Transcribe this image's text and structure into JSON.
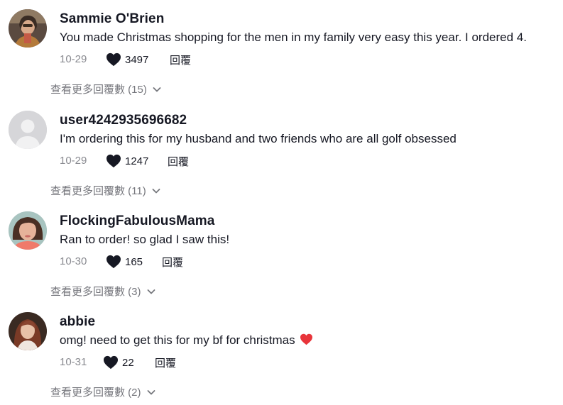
{
  "comments": [
    {
      "username": "Sammie O'Brien",
      "text": "You made Christmas shopping for the men in my family very easy this year. I ordered 4.",
      "date": "10-29",
      "likes": "3497",
      "reply_label": "回覆",
      "view_replies_label": "查看更多回覆數 (15)"
    },
    {
      "username": "user4242935696682",
      "text": "I'm ordering this for my husband and two friends who are all golf obsessed",
      "date": "10-29",
      "likes": "1247",
      "reply_label": "回覆",
      "view_replies_label": "查看更多回覆數 (11)"
    },
    {
      "username": "FlockingFabulousMama",
      "text": "Ran to order! so glad I saw this!",
      "date": "10-30",
      "likes": "165",
      "reply_label": "回覆",
      "view_replies_label": "查看更多回覆數 (3)"
    },
    {
      "username": "abbie",
      "text": "omg! need to get this for my bf for christmas",
      "text_emoji": "red-heart-emoji",
      "date": "10-31",
      "likes": "22",
      "reply_label": "回覆",
      "view_replies_label": "查看更多回覆數 (2)"
    }
  ],
  "icons": {
    "like": "heart-icon",
    "expand": "chevron-down-icon"
  },
  "colors": {
    "text_primary": "#161823",
    "text_secondary": "#8a8b91",
    "emoji_heart": "#e8343a"
  }
}
